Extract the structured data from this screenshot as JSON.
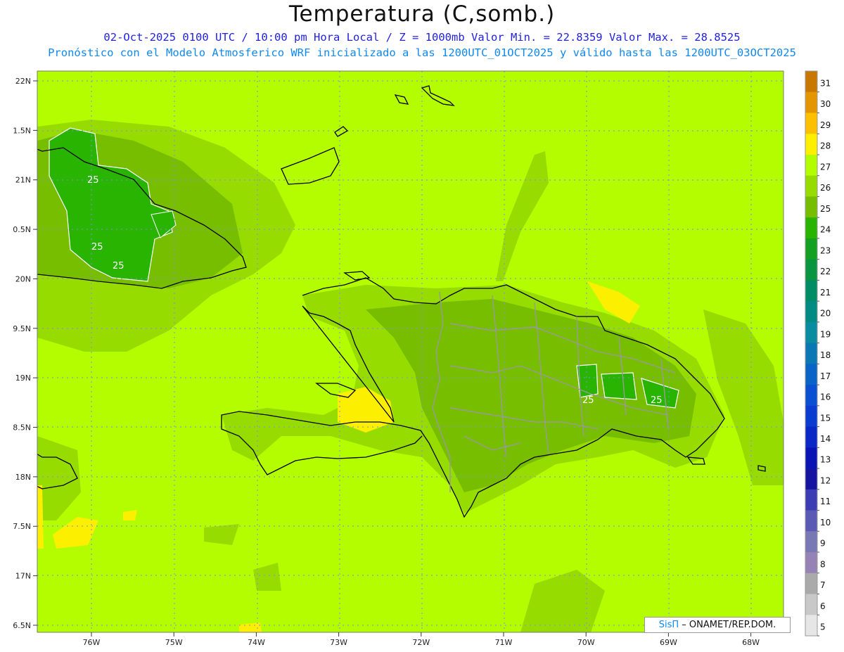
{
  "header": {
    "title": "Temperatura (C,somb.)",
    "line1": "02-Oct-2025 0100 UTC / 10:00 pm Hora Local / Z = 1000mb  Valor Min. = 22.8359  Valor Max. = 28.8525",
    "line2": "Pronóstico con el Modelo Atmosferico WRF inicializado a las 1200UTC_01OCT2025 y válido hasta las  1200UTC_03OCT2025"
  },
  "axes": {
    "y_ticks": [
      "22N",
      "1.5N",
      "21N",
      "0.5N",
      "20N",
      "9.5N",
      "19N",
      "8.5N",
      "18N",
      "7.5N",
      "17N",
      "6.5N"
    ],
    "x_ticks": [
      "76W",
      "75W",
      "74W",
      "73W",
      "72W",
      "71W",
      "70W",
      "69W",
      "68W"
    ]
  },
  "colorbar": {
    "labels": [
      "31",
      "30",
      "29",
      "28",
      "27",
      "26",
      "25",
      "24",
      "23",
      "22",
      "21",
      "20",
      "19",
      "18",
      "17",
      "16",
      "15",
      "14",
      "13",
      "12",
      "11",
      "10",
      "9",
      "8",
      "7",
      "6",
      "5"
    ],
    "colors": [
      "#c87800",
      "#e49600",
      "#fcc000",
      "#fcf000",
      "#b4fc00",
      "#96dc00",
      "#78be00",
      "#28b400",
      "#14a020",
      "#0a9640",
      "#008c64",
      "#008c82",
      "#0a8ca0",
      "#0a78b4",
      "#0a64c8",
      "#0a50d2",
      "#0a3cd2",
      "#0a28c8",
      "#0a14b4",
      "#1414a0",
      "#3c3cb4",
      "#5a5ab4",
      "#7878b4",
      "#9682b4",
      "#aaaaaa",
      "#c8c8c8",
      "#e6e6e6"
    ]
  },
  "map": {
    "background_color": "#b4fc00",
    "contour_label": "25"
  },
  "credit": {
    "brand": "SisΠ",
    "text": " – ONAMET/REP.DOM."
  }
}
